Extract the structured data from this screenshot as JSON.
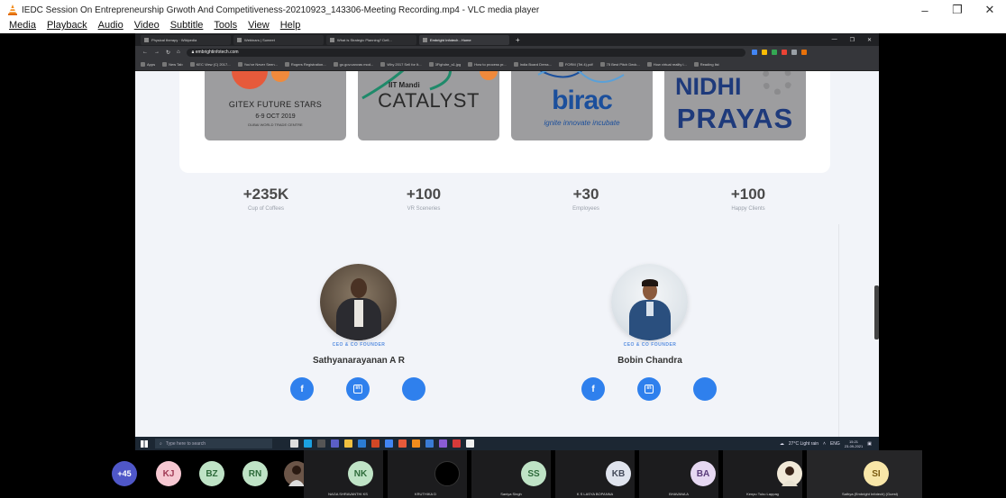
{
  "window": {
    "title": "IEDC Session On Entrepreneurship Grwoth And Competitiveness-20210923_143306-Meeting Recording.mp4 - VLC media player",
    "minimize": "–",
    "restore": "❐",
    "close": "✕"
  },
  "menu": [
    "Media",
    "Playback",
    "Audio",
    "Video",
    "Subtitle",
    "Tools",
    "View",
    "Help"
  ],
  "browser": {
    "tabs": [
      "Physical therapy · Wikipedia",
      "Webinars | Sumeet",
      "What is Strategic Planning? Defi...",
      "Embright Infotech - Home"
    ],
    "new_tab": "+",
    "url": "embrightinfotech.com",
    "bookmarks": [
      "Apps",
      "New Tab",
      "KEC View (C) 2017...",
      "You've Never Seen...",
      "Rogers Registration...",
      "go.gov.canvas mod...",
      "Why 2017 Sell for It...",
      "3Fighdre_s1.jpg",
      "How to process pr...",
      "India Board Dress...",
      "FORM (Tel.4).pdf",
      "75 Best Pitch Deck...",
      "How virtual reality i...",
      "Reading list"
    ]
  },
  "logos": {
    "gitex_title": "GITEX FUTURE STARS",
    "gitex_date": "6-9 OCT 2019",
    "gitex_venue": "DUBAI WORLD TRADE CENTRE",
    "iit_small": "IIT Mandi",
    "iit_big": "CATALYST",
    "birac_big": "birac",
    "birac_tag": "ignite innovate incubate",
    "nidhi": "NIDHI",
    "prayas": "PRAYAS"
  },
  "stats": [
    {
      "value": "+235K",
      "label": "Cup of Coffees"
    },
    {
      "value": "+100",
      "label": "VR Sceneries"
    },
    {
      "value": "+30",
      "label": "Employees"
    },
    {
      "value": "+100",
      "label": "Happy Clients"
    }
  ],
  "founders": [
    {
      "role": "CEO & CO FOUNDER",
      "name": "Sathyanarayanan A R"
    },
    {
      "role": "CEO & CO FOUNDER",
      "name": "Bobin Chandra"
    }
  ],
  "social": {
    "facebook": "f",
    "linkedin": "in"
  },
  "taskbar": {
    "search": "Type here to search",
    "weather": "27°C  Light rain",
    "lang": "ENG",
    "time": "15:21",
    "date": "23-09-2021"
  },
  "participants": {
    "more": "+45",
    "avatars": [
      {
        "initials": "KJ",
        "color": "#f6c8d2",
        "fg": "#a03a55"
      },
      {
        "initials": "BZ",
        "color": "#bfe3c6",
        "fg": "#2e6b3b"
      },
      {
        "initials": "RN",
        "color": "#bfe3c6",
        "fg": "#2e6b3b"
      }
    ],
    "tiles": [
      {
        "initials": "NK",
        "name": "NAGA SHRAVANTHI KS",
        "color": "#bfe3c6",
        "fg": "#2e6b3b"
      },
      {
        "initials": "",
        "name": "KRUTHIKA D",
        "color": "#000000",
        "fg": "#000000"
      },
      {
        "initials": "SS",
        "name": "Saniya Singh",
        "color": "#bfe3c6",
        "fg": "#2e6b3b"
      },
      {
        "initials": "KB",
        "name": "K S LASYA BOPANNA",
        "color": "#e0e4ee",
        "fg": "#444a5a"
      },
      {
        "initials": "BA",
        "name": "BHAVANA A",
        "color": "#e6d8f2",
        "fg": "#5a3c7a"
      },
      {
        "initials": "",
        "name": "Kenpu Tuku Lappag",
        "color": "#f1e9d8",
        "fg": "#6a5a3a"
      },
      {
        "initials": "SI",
        "name": "Sathya (Embright Infotech) (Guest)",
        "color": "#f8e6a8",
        "fg": "#7a5a10"
      }
    ]
  }
}
